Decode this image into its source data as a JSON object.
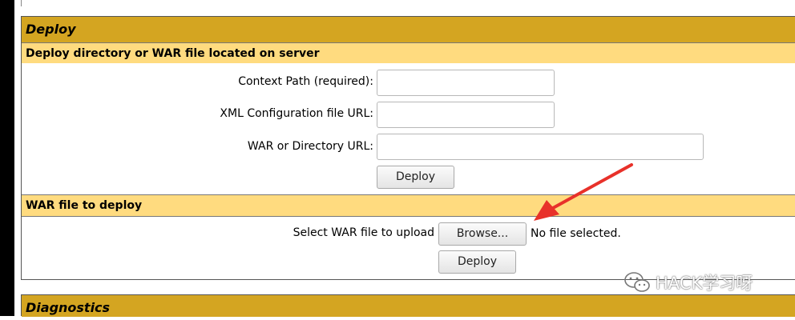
{
  "deploy": {
    "title": "Deploy",
    "server_section": {
      "title": "Deploy directory or WAR file located on server",
      "context_path_label": "Context Path (required):",
      "context_path_value": "",
      "xml_config_label": "XML Configuration file URL:",
      "xml_config_value": "",
      "war_dir_label": "WAR or Directory URL:",
      "war_dir_value": "",
      "deploy_button": "Deploy"
    },
    "upload_section": {
      "title": "WAR file to deploy",
      "select_label": "Select WAR file to upload",
      "browse_button": "Browse...",
      "file_status": "No file selected.",
      "deploy_button": "Deploy"
    }
  },
  "diagnostics": {
    "title": "Diagnostics"
  },
  "annotation": {
    "arrow_color": "#e8312a"
  },
  "watermark": {
    "text": "HACK学习呀",
    "icon": "wechat-icon"
  },
  "colors": {
    "section_header": "#d4a521",
    "sub_header": "#ffdb7f"
  }
}
